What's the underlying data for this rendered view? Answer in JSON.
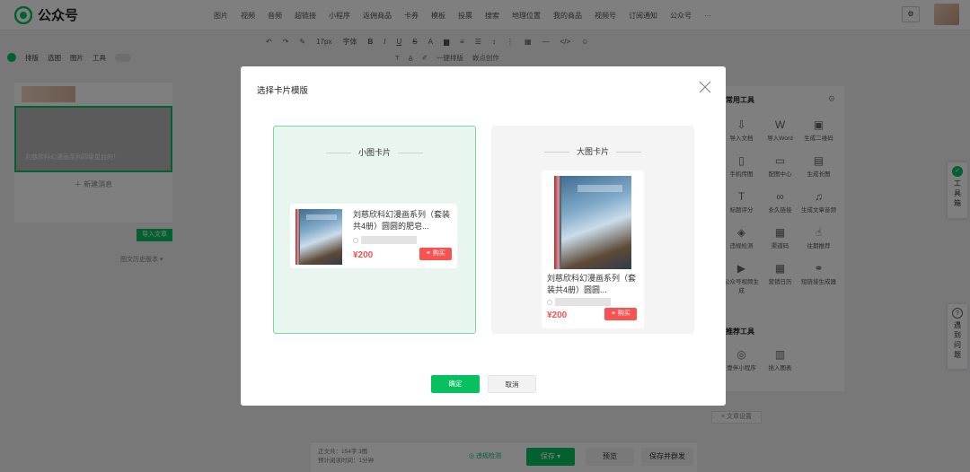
{
  "app": {
    "name": "公众号",
    "brand_color": "#07c160"
  },
  "topnav": {
    "items": [
      "图片",
      "视频",
      "音频",
      "超链接",
      "小程序",
      "返佣商品",
      "卡券",
      "模板",
      "投票",
      "搜索",
      "地理位置",
      "我的商品",
      "视频号",
      "订阅通知",
      "公众号",
      "···"
    ]
  },
  "toolbar": {
    "font_size": "17px",
    "font_label": "字体",
    "left_items": [
      "排版",
      "选图",
      "图片",
      "工具"
    ],
    "one_click_layout": "一键排版",
    "ai_layout": "嵌点创作"
  },
  "left_panel": {
    "article_title": "刘慈欣科幻漫画系列四级星台的！",
    "new_message": "新建消息",
    "import_button": "导入文章",
    "history_label": "图文历史版本"
  },
  "right_panel": {
    "title": "常用工具",
    "tools": [
      {
        "label": "导入文档",
        "icon": "import-icon"
      },
      {
        "label": "导入Word",
        "icon": "word-icon"
      },
      {
        "label": "生成二维码",
        "icon": "qrcode-icon"
      },
      {
        "label": "手机传图",
        "icon": "phone-icon"
      },
      {
        "label": "配图中心",
        "icon": "image-icon"
      },
      {
        "label": "生成长图",
        "icon": "long-image-icon"
      },
      {
        "label": "标题评分",
        "icon": "title-icon"
      },
      {
        "label": "永久链接",
        "icon": "link-icon"
      },
      {
        "label": "生成文章音频",
        "icon": "audio-icon"
      },
      {
        "label": "违规检测",
        "icon": "shield-icon"
      },
      {
        "label": "渠道码",
        "icon": "channel-code-icon"
      },
      {
        "label": "往期推荐",
        "icon": "thumb-icon"
      },
      {
        "label": "公众号视频生成",
        "icon": "video-icon"
      },
      {
        "label": "营销日历",
        "icon": "calendar-icon"
      },
      {
        "label": "短链接生成器",
        "icon": "short-link-icon"
      }
    ],
    "title2": "推荐工具",
    "tools2": [
      {
        "label": "壹伴小程序",
        "icon": "miniapp-icon"
      },
      {
        "label": "插入图表",
        "icon": "chart-icon"
      }
    ],
    "article_settings": "文章设置"
  },
  "side_tabs": {
    "toolbox": "工具箱",
    "help": "遇到问题"
  },
  "bottom_bar": {
    "stats_line1": "正文共：154字 3图",
    "stats_line2": "预计阅读时间：1分钟",
    "check_label": "违规检测",
    "save": "保存",
    "preview": "预览",
    "publish": "保存并群发"
  },
  "dialog": {
    "title": "选择卡片模版",
    "small_card": {
      "heading": "小图卡片",
      "product_name": "刘慈欣科幻漫画系列（套装共4册）圆圆的肥皂...",
      "price": "¥200",
      "buy": "购买"
    },
    "large_card": {
      "heading": "大图卡片",
      "product_name": "刘慈欣科幻漫画系列（套装共4册）圆圆...",
      "price": "¥200",
      "buy": "购买"
    },
    "confirm": "确定",
    "cancel": "取消"
  }
}
